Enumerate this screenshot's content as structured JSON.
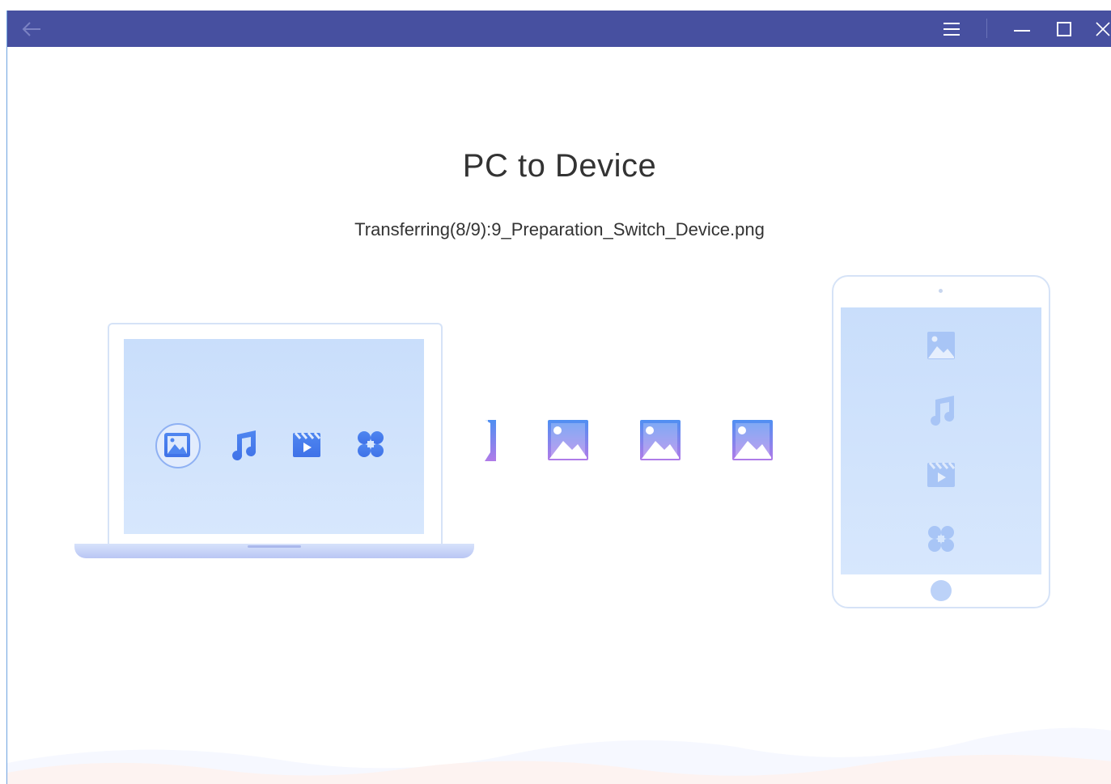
{
  "window": {
    "title_bar_color": "#4750a0",
    "controls": {
      "back_icon": "arrow-left-icon",
      "menu_icon": "hamburger-menu-icon",
      "minimize_icon": "minimize-icon",
      "maximize_icon": "maximize-icon",
      "close_icon": "close-icon"
    }
  },
  "main": {
    "title": "PC to Device",
    "status": "Transferring(8/9):9_Preparation_Switch_Device.png",
    "progress": {
      "current": 8,
      "total": 9
    }
  },
  "laptop": {
    "icons": [
      "photo-icon",
      "music-icon",
      "video-icon",
      "apps-icon"
    ],
    "selected_icon": "photo-icon"
  },
  "transfer": {
    "icons": [
      "photo-icon",
      "photo-icon",
      "photo-icon",
      "photo-icon"
    ]
  },
  "tablet": {
    "icons": [
      "photo-icon",
      "music-icon",
      "video-icon",
      "apps-icon"
    ]
  },
  "colors": {
    "accent": "#4750a0",
    "icon_blue": "#4f86f0",
    "icon_purple": "#a774ec",
    "screen_blue": "#c9defb"
  }
}
